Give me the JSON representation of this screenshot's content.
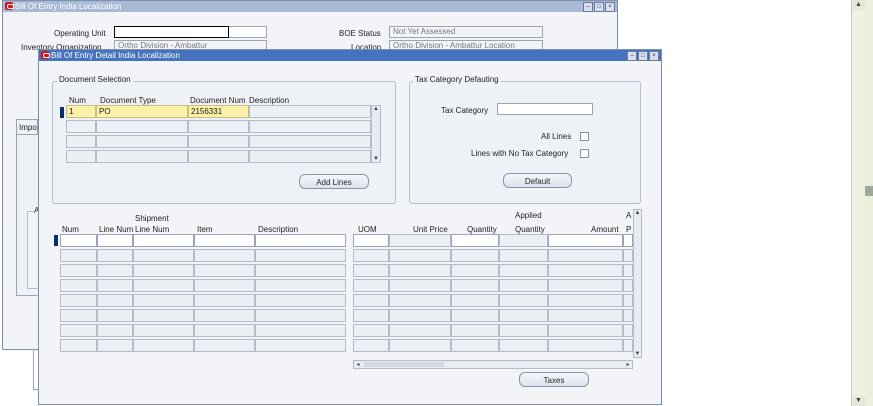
{
  "back_window": {
    "title": "Bill Of Entry India Localization",
    "operating_unit_label": "Operating Unit",
    "operating_unit_value": "",
    "inventory_org_label": "Inventory Organization",
    "inventory_org_value": "Ortho Division - Ambattur",
    "boe_status_label": "BOE Status",
    "boe_status_value": "Not Yet Assessed",
    "location_label": "Location",
    "location_value": "Ortho Division - Ambattur Location",
    "tab_imports_label": "Impo",
    "group_a_label": "A"
  },
  "detail_window": {
    "title": "Bill Of Entry Detail India Localization",
    "document_selection": {
      "title": "Document Selection",
      "columns": [
        "Num",
        "Document Type",
        "Document Num",
        "Description"
      ],
      "rows": [
        {
          "num": "1",
          "type": "PO",
          "doc_num": "2156331",
          "description": ""
        }
      ],
      "add_lines_label": "Add Lines"
    },
    "tax_category": {
      "title": "Tax Category Defauting",
      "tax_category_label": "Tax Category",
      "tax_category_value": "",
      "all_lines_label": "All Lines",
      "no_tax_label": "Lines with No Tax Category",
      "default_label": "Default",
      "default_mnemonic": "D"
    },
    "lines_left": {
      "columns": {
        "num": "Num",
        "line_num": "Line Num",
        "shipment_top": "Shipment",
        "shipment_line": "Line Num",
        "item": "Item",
        "description": "Description"
      }
    },
    "lines_right": {
      "columns": {
        "uom": "UOM",
        "unit_price": "Unit Price",
        "quantity": "Quantity",
        "applied_top": "Applied",
        "applied_qty": "Quantity",
        "amount": "Amount",
        "a_top": "A",
        "a_bottom": "P"
      }
    },
    "taxes_label": "Taxes",
    "taxes_mnemonic": "a"
  },
  "colors": {
    "active_title": "#4573c0",
    "inactive_title": "#a9bad6",
    "highlight_row": "#fbf0a8",
    "window_bg": "#f2f4f8"
  }
}
